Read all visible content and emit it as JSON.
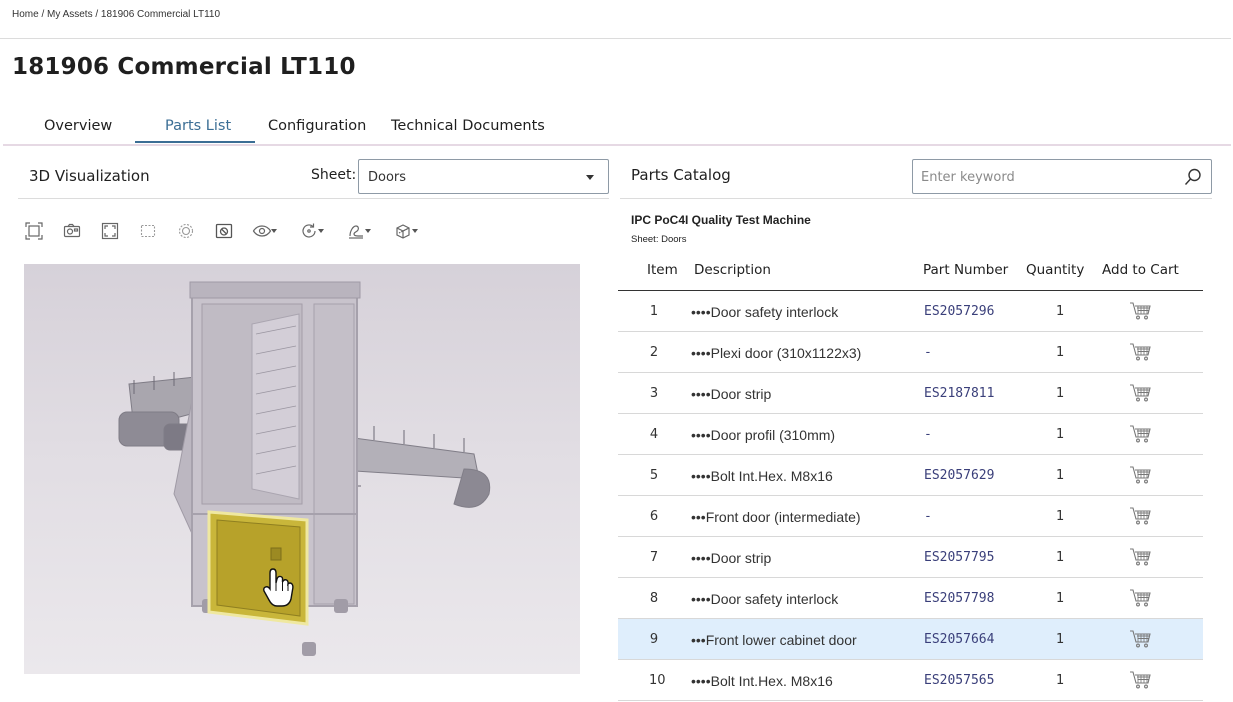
{
  "breadcrumb": "Home / My Assets / 181906 Commercial LT110",
  "page_title": "181906 Commercial LT110",
  "tabs": [
    {
      "label": "Overview"
    },
    {
      "label": "Parts List"
    },
    {
      "label": "Configuration"
    },
    {
      "label": "Technical Documents"
    }
  ],
  "active_tab": "Parts List",
  "visualization": {
    "title": "3D Visualization",
    "sheet_label": "Sheet:",
    "sheet_value": "Doors",
    "tools": [
      "fit-view-icon",
      "snapshot-icon",
      "fullscreen-icon",
      "selection-box-icon",
      "explode-icon",
      "isolate-icon",
      "visibility-icon",
      "rotate-icon",
      "render-mode-icon",
      "section-icon"
    ]
  },
  "catalog": {
    "title": "Parts Catalog",
    "search_placeholder": "Enter keyword",
    "machine_name": "IPC PoC4I Quality Test Machine",
    "sheet_line": "Sheet: Doors",
    "columns": {
      "item": "Item",
      "description": "Description",
      "part_number": "Part Number",
      "quantity": "Quantity",
      "add_to_cart": "Add to Cart"
    },
    "rows": [
      {
        "item": "1",
        "description": "••••Door safety interlock",
        "part_number": "ES2057296",
        "quantity": "1"
      },
      {
        "item": "2",
        "description": "••••Plexi door (310x1122x3)",
        "part_number": "-",
        "quantity": "1"
      },
      {
        "item": "3",
        "description": "••••Door strip",
        "part_number": "ES2187811",
        "quantity": "1"
      },
      {
        "item": "4",
        "description": "••••Door profil (310mm)",
        "part_number": "-",
        "quantity": "1"
      },
      {
        "item": "5",
        "description": "••••Bolt Int.Hex. M8x16",
        "part_number": "ES2057629",
        "quantity": "1"
      },
      {
        "item": "6",
        "description": "•••Front door (intermediate)",
        "part_number": "-",
        "quantity": "1"
      },
      {
        "item": "7",
        "description": "••••Door strip",
        "part_number": "ES2057795",
        "quantity": "1"
      },
      {
        "item": "8",
        "description": "••••Door safety interlock",
        "part_number": "ES2057798",
        "quantity": "1"
      },
      {
        "item": "9",
        "description": "•••Front lower cabinet door",
        "part_number": "ES2057664",
        "quantity": "1"
      },
      {
        "item": "10",
        "description": "••••Bolt Int.Hex. M8x16",
        "part_number": "ES2057565",
        "quantity": "1"
      }
    ],
    "selected_row": "9"
  },
  "colors": {
    "accent": "#3b6e95",
    "selected_row": "#dfeefc",
    "highlight_part": "#c9b63a"
  }
}
